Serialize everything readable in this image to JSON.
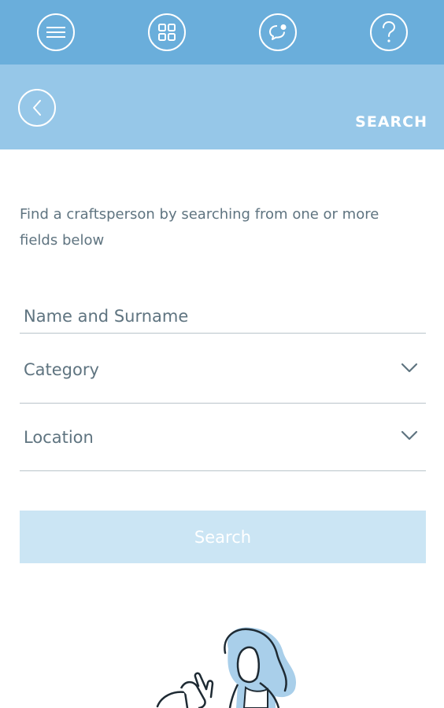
{
  "topbar": {
    "icons": [
      "menu-icon",
      "grid-icon",
      "chat-icon",
      "help-icon"
    ]
  },
  "header": {
    "title": "SEARCH"
  },
  "intro": {
    "text": "Find a craftsperson by searching from one or more fields below"
  },
  "form": {
    "name_placeholder": "Name and Surname",
    "category_label": "Category",
    "location_label": "Location",
    "search_label": "Search"
  },
  "colors": {
    "topbar": "#6aaedb",
    "header": "#96c7e8",
    "button_disabled": "#cbe5f4",
    "text": "#5f7480"
  }
}
